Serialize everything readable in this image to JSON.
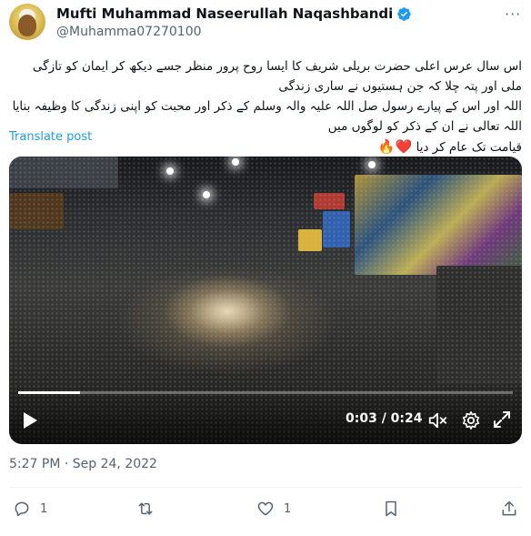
{
  "author": {
    "name": "Mufti Muhammad Naseerullah Naqashbandi",
    "handle": "@Muhamma07270100",
    "verified": true
  },
  "post": {
    "text_line1": "اس سال عرس اعلی حضرت بریلی شریف کا ایسا روح پرور منظر جسے دیکھ کر ایمان کو تازگی ملی اور پتہ چلا کہ جن ہستیوں نے ساری زندگی",
    "text_line2": "اللہ اور اس کے پیارے رسول صل اللہ علیہ والہ وسلم کے ذکر اور محبت کو اپنی زندگی کا وظیفہ بنایا اللہ تعالی نے ان کے ذکر کو لوگوں میں",
    "text_line3": "قیامت تک عام کر دیا",
    "emoji": "❤️🔥",
    "translate_label": "Translate post",
    "timestamp": "5:27 PM · Sep 24, 2022"
  },
  "video": {
    "time_display": "0:03 / 0:24",
    "progress": 0.125
  },
  "actions": {
    "reply_count": "1",
    "retweet_count": "",
    "like_count": "1",
    "bookmark_count": "",
    "share_count": ""
  },
  "colors": {
    "accent": "#1d9bf0",
    "secondary_text": "#536471",
    "like": "#f91880"
  }
}
